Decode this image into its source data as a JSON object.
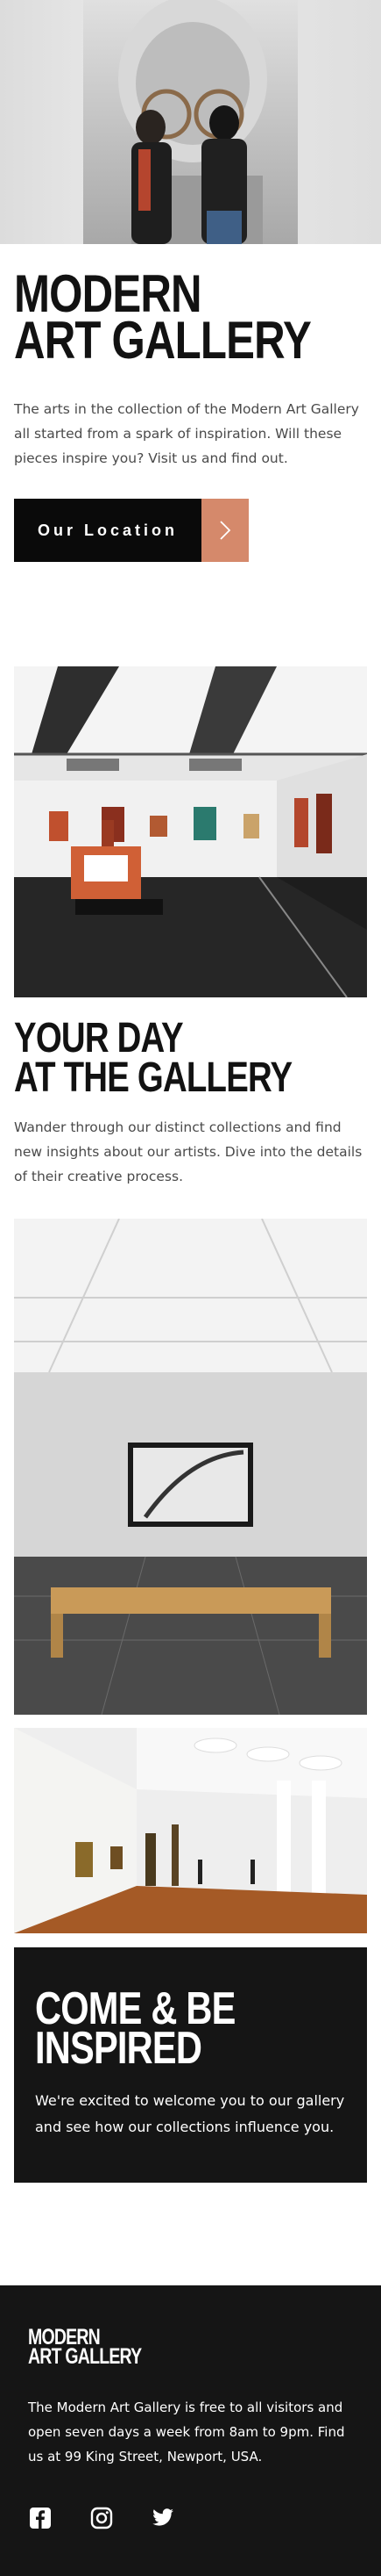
{
  "hero": {
    "title_line1": "Modern",
    "title_line2": "Art Gallery",
    "text": "The arts in the collection of the Modern Art Gallery all started from a spark of inspiration. Will these pieces inspire you? Visit us and find out.",
    "button_label": "Our Location",
    "button_icon": "chevron-right-icon"
  },
  "day": {
    "title_line1": "Your Day",
    "title_line2": "at the gallery",
    "text": "Wander through our distinct collections and find new insights about our artists. Dive into the details of their creative process."
  },
  "inspired": {
    "title_line1": "Come & Be",
    "title_line2": "Inspired",
    "text": "We're excited to welcome you to our gallery and see how our collections influence you."
  },
  "footer": {
    "logo_line1": "Modern",
    "logo_line2": "Art Gallery",
    "text": "The Modern Art Gallery is free to all visitors and open seven days a week from 8am to 9pm. Find us at 99 King Street, Newport, USA.",
    "socials": [
      "facebook-icon",
      "instagram-icon",
      "twitter-icon"
    ]
  },
  "colors": {
    "accent": "#d5896b",
    "dark": "#151515",
    "text": "#4a4a4a"
  }
}
